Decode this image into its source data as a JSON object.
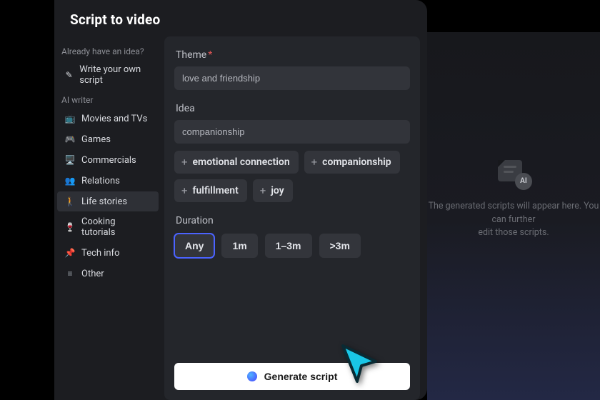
{
  "title": "Script to video",
  "sidebar": {
    "have_idea_label": "Already have an idea?",
    "write_own_label": "Write your own script",
    "ai_writer_label": "AI writer",
    "items": [
      {
        "label": "Movies and TVs",
        "icon": "📺",
        "color": "#2f6bff"
      },
      {
        "label": "Games",
        "icon": "🎮",
        "color": "#a23bff"
      },
      {
        "label": "Commercials",
        "icon": "🖥️",
        "color": "#2fa8ff"
      },
      {
        "label": "Relations",
        "icon": "👥",
        "color": "#9aa0a8"
      },
      {
        "label": "Life stories",
        "icon": "🚶",
        "color": "#25c19b",
        "selected": true
      },
      {
        "label": "Cooking tutorials",
        "icon": "🍷",
        "color": "#c14b7a"
      },
      {
        "label": "Tech info",
        "icon": "📌",
        "color": "#2fc1b0"
      },
      {
        "label": "Other",
        "icon": "≡",
        "color": "#9aa0a8"
      }
    ]
  },
  "form": {
    "theme_label": "Theme",
    "theme_value": "love and friendship",
    "idea_label": "Idea",
    "idea_value": "companionship",
    "tags": [
      "emotional connection",
      "companionship",
      "fulfillment",
      "joy"
    ],
    "duration_label": "Duration",
    "durations": [
      {
        "label": "Any",
        "active": true
      },
      {
        "label": "1m",
        "active": false
      },
      {
        "label": "1–3m",
        "active": false
      },
      {
        "label": ">3m",
        "active": false
      }
    ],
    "generate_label": "Generate script"
  },
  "right": {
    "placeholder_badge": "AI",
    "text_line1": "The generated scripts will appear here. You can further",
    "text_line2": "edit those scripts."
  }
}
